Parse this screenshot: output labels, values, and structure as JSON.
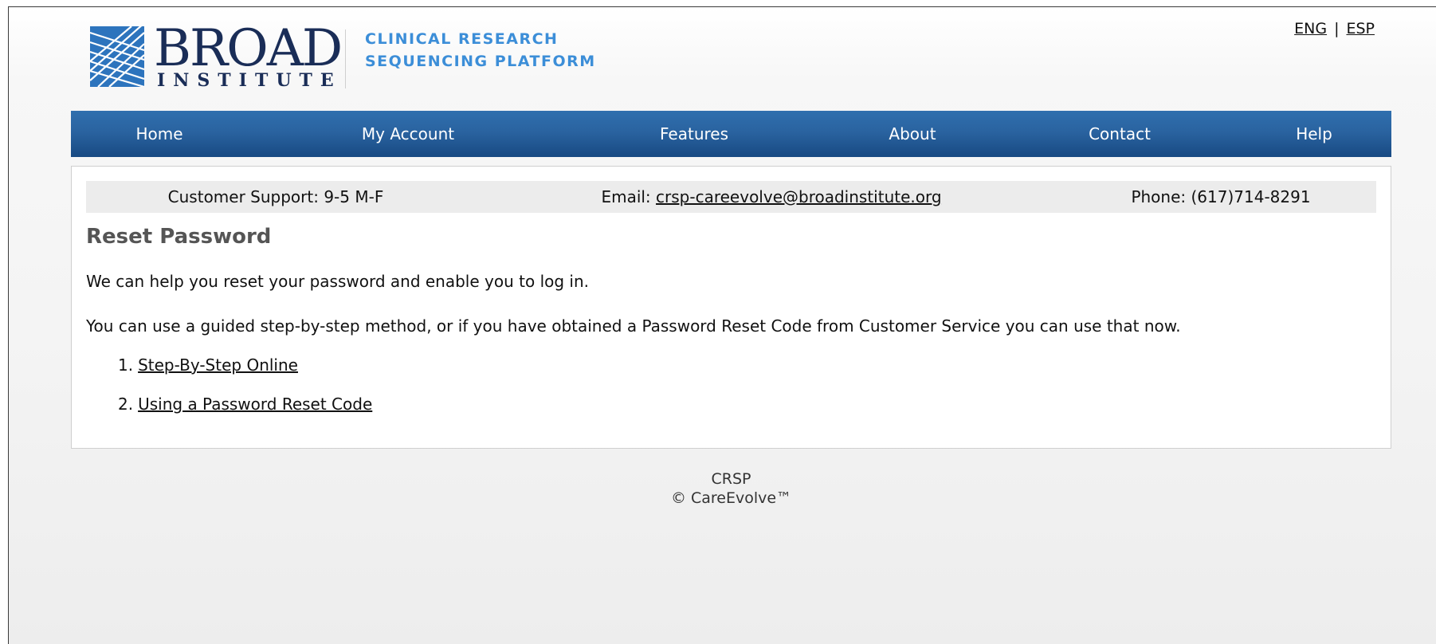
{
  "brand": {
    "wordmark": "BROAD",
    "sub_wordmark": "INSTITUTE",
    "tagline_line1": "CLINICAL RESEARCH",
    "tagline_line2": "SEQUENCING PLATFORM",
    "logo_color": "#1a2d57",
    "tagline_color": "#3c8ed8"
  },
  "language": {
    "options": [
      "ENG",
      "ESP"
    ],
    "separator": "|"
  },
  "nav": {
    "color": "#2a63a0",
    "items": [
      {
        "label": "Home"
      },
      {
        "label": "My Account"
      },
      {
        "label": "Features"
      },
      {
        "label": "About"
      },
      {
        "label": "Contact"
      },
      {
        "label": "Help"
      }
    ]
  },
  "support": {
    "hours": "Customer Support: 9-5 M-F",
    "email_label": "Email:",
    "email": "crsp-careevolve@broadinstitute.org",
    "phone": "Phone: (617)714-8291"
  },
  "main": {
    "title": "Reset Password",
    "intro": "We can help you reset your password and enable you to log in.",
    "description": "You can use a guided step-by-step method, or if you have obtained a Password Reset Code from Customer Service you can use that now.",
    "options": [
      {
        "number": "1.",
        "label": "Step-By-Step Online"
      },
      {
        "number": "2.",
        "label": "Using a Password Reset Code"
      }
    ]
  },
  "footer": {
    "line1": "CRSP",
    "line2": "© CareEvolve™"
  }
}
